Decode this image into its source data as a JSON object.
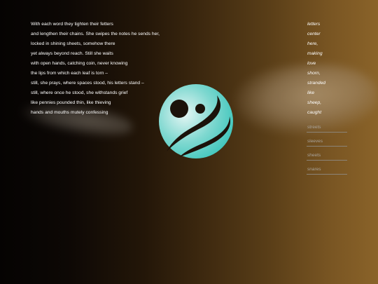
{
  "poem": {
    "lines": [
      "With each word they tighten their fetters",
      "and lengthen their chains. She swipes the notes he sends her,",
      "locked in shining sheets, somehow there",
      "yet always beyond reach. Still she waits",
      "with open hands, catching coin, never knowing",
      "the lips from which each leaf is torn –",
      "still, she prays, where spaces stood, his letters stand –",
      "still, where once he stood, she withstands grief",
      "like pennies pounded thin, like thieving",
      "hands and mouths mutely confessing"
    ],
    "end_words": [
      "letters",
      "center",
      "here,",
      "making",
      "love",
      "shorn,",
      "stranded",
      "like",
      "sheep,",
      "caught"
    ]
  },
  "choices": [
    "streets",
    "sleeves",
    "sheets",
    "snares"
  ],
  "logo": {
    "icon": "swirl-logo-icon",
    "accent_color": "#3fc6bc",
    "light_color": "#e6f6f4"
  }
}
